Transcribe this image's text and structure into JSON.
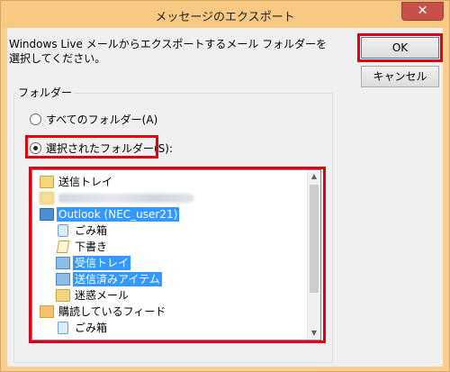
{
  "window": {
    "title": "メッセージのエクスポート",
    "close_glyph": "✕"
  },
  "message": "Windows Live メールからエクスポートするメール フォルダーを選択してください。",
  "buttons": {
    "ok": "OK",
    "cancel": "キャンセル"
  },
  "folder_group": {
    "label": "フォルダー",
    "radio_all": "すべてのフォルダー(A)",
    "radio_selected": "選択されたフォルダー(S):",
    "selected_option": "radio_selected"
  },
  "tree": {
    "items": [
      {
        "label": "送信トレイ",
        "icon": "outbox-folder-icon",
        "selected": false
      },
      {
        "label": "",
        "icon": "folder-icon",
        "selected": false,
        "redacted": true
      },
      {
        "label": "Outlook (NEC_user21)",
        "icon": "outlook-account-icon",
        "selected": true
      },
      {
        "label": "ごみ箱",
        "icon": "trash-icon",
        "selected": false
      },
      {
        "label": "下書き",
        "icon": "draft-icon",
        "selected": false
      },
      {
        "label": "受信トレイ",
        "icon": "inbox-icon",
        "selected": true
      },
      {
        "label": "送信済みアイテム",
        "icon": "sent-folder-icon",
        "selected": true
      },
      {
        "label": "迷惑メール",
        "icon": "folder-icon",
        "selected": false
      },
      {
        "label": "購読しているフィード",
        "icon": "feed-folder-icon",
        "selected": false
      },
      {
        "label": "ごみ箱",
        "icon": "trash-icon",
        "selected": false
      }
    ]
  },
  "colors": {
    "title_bar": "#f8c982",
    "selection": "#3399ff",
    "highlight_border": "#e00010",
    "dialog_bg": "#f0f0f0"
  }
}
